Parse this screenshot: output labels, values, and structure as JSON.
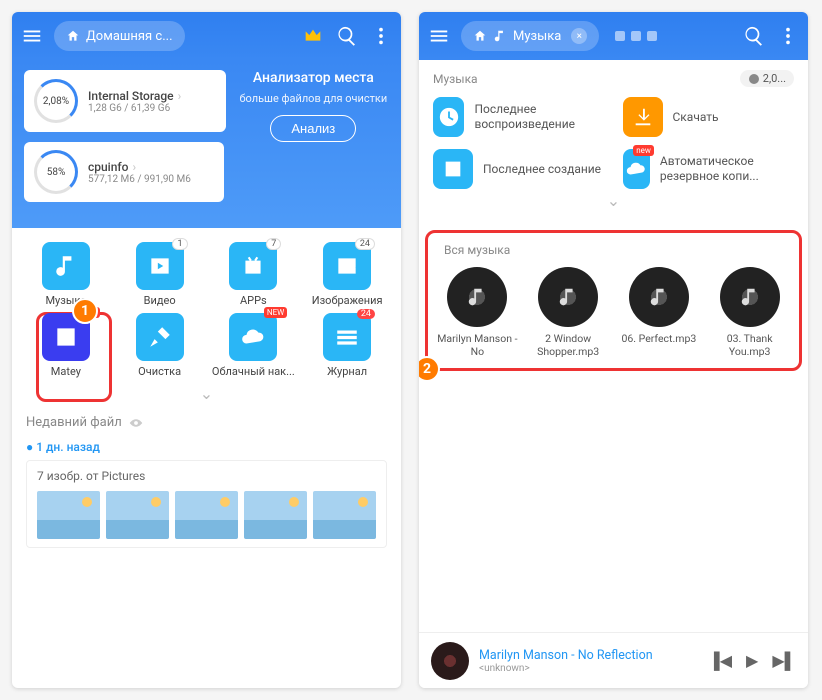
{
  "left": {
    "breadcrumb": "Домашняя с...",
    "hero": {
      "analyzer_title": "Анализатор места",
      "analyzer_sub": "больше файлов для очистки",
      "analyze_btn": "Анализ"
    },
    "storage": {
      "percent": "2,08%",
      "title": "Internal Storage",
      "sub": "1,28 G6 / 61,39 G6"
    },
    "cpu": {
      "percent": "58%",
      "title": "cpuinfo",
      "sub": "577,12 M6 / 991,90 M6"
    },
    "grid": [
      {
        "label": "Музыка",
        "color": "#2ab6f6",
        "icon": "music"
      },
      {
        "label": "Видео",
        "color": "#2ab6f6",
        "icon": "video",
        "badge": "1"
      },
      {
        "label": "APPs",
        "color": "#2ab6f6",
        "icon": "android",
        "badge": "7"
      },
      {
        "label": "Изображения",
        "color": "#2ab6f6",
        "icon": "image",
        "badge": "24"
      },
      {
        "label": "Matey",
        "color": "#3a3df0",
        "icon": "matey",
        "new": true
      },
      {
        "label": "Очистка",
        "color": "#2ab6f6",
        "icon": "broom"
      },
      {
        "label": "Облачный нак...",
        "color": "#2ab6f6",
        "icon": "cloud",
        "new": true
      },
      {
        "label": "Журнал",
        "color": "#2ab6f6",
        "icon": "stack",
        "redbadge": "24"
      }
    ],
    "recent_header": "Недавний файл",
    "recent_time": "1 дн. назад",
    "recent_card": "7 изобр. от Pictures",
    "callout": "1"
  },
  "right": {
    "breadcrumb": "Музыка",
    "subhead": "Музыка",
    "size_chip": "2,0...",
    "quick": [
      {
        "label": "Последнее воспроизведение",
        "color": "#2ab6f6",
        "icon": "clock"
      },
      {
        "label": "Скачать",
        "color": "#ff9800",
        "icon": "download"
      },
      {
        "label": "Последнее создание",
        "color": "#2ab6f6",
        "icon": "plus"
      },
      {
        "label": "Автоматическое резервное копи...",
        "color": "#2ab6f6",
        "icon": "cloud",
        "new": true
      }
    ],
    "all_music_header": "Вся музыка",
    "tracks": [
      {
        "label": "Marilyn Manson - No"
      },
      {
        "label": "2 Window Shopper.mp3"
      },
      {
        "label": "06. Perfect.mp3"
      },
      {
        "label": "03. Thank You.mp3"
      }
    ],
    "player": {
      "title": "Marilyn Manson - No Reflection",
      "artist": "<unknown>"
    },
    "callout": "2"
  }
}
